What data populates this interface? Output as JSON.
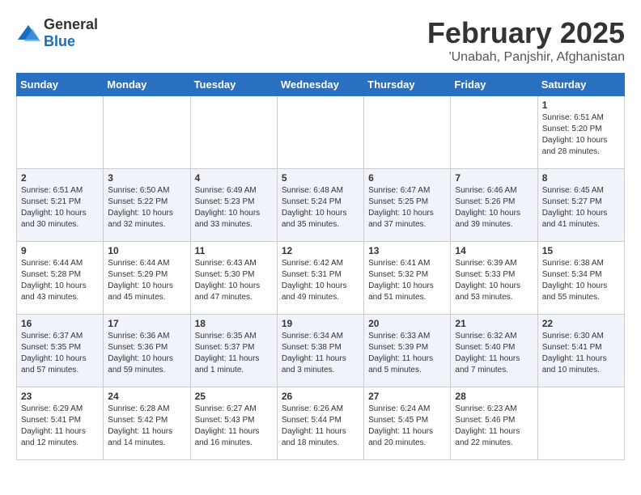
{
  "logo": {
    "general": "General",
    "blue": "Blue"
  },
  "title": "February 2025",
  "subtitle": "'Unabah, Panjshir, Afghanistan",
  "weekdays": [
    "Sunday",
    "Monday",
    "Tuesday",
    "Wednesday",
    "Thursday",
    "Friday",
    "Saturday"
  ],
  "weeks": [
    [
      {
        "day": "",
        "info": ""
      },
      {
        "day": "",
        "info": ""
      },
      {
        "day": "",
        "info": ""
      },
      {
        "day": "",
        "info": ""
      },
      {
        "day": "",
        "info": ""
      },
      {
        "day": "",
        "info": ""
      },
      {
        "day": "1",
        "info": "Sunrise: 6:51 AM\nSunset: 5:20 PM\nDaylight: 10 hours and 28 minutes."
      }
    ],
    [
      {
        "day": "2",
        "info": "Sunrise: 6:51 AM\nSunset: 5:21 PM\nDaylight: 10 hours and 30 minutes."
      },
      {
        "day": "3",
        "info": "Sunrise: 6:50 AM\nSunset: 5:22 PM\nDaylight: 10 hours and 32 minutes."
      },
      {
        "day": "4",
        "info": "Sunrise: 6:49 AM\nSunset: 5:23 PM\nDaylight: 10 hours and 33 minutes."
      },
      {
        "day": "5",
        "info": "Sunrise: 6:48 AM\nSunset: 5:24 PM\nDaylight: 10 hours and 35 minutes."
      },
      {
        "day": "6",
        "info": "Sunrise: 6:47 AM\nSunset: 5:25 PM\nDaylight: 10 hours and 37 minutes."
      },
      {
        "day": "7",
        "info": "Sunrise: 6:46 AM\nSunset: 5:26 PM\nDaylight: 10 hours and 39 minutes."
      },
      {
        "day": "8",
        "info": "Sunrise: 6:45 AM\nSunset: 5:27 PM\nDaylight: 10 hours and 41 minutes."
      }
    ],
    [
      {
        "day": "9",
        "info": "Sunrise: 6:44 AM\nSunset: 5:28 PM\nDaylight: 10 hours and 43 minutes."
      },
      {
        "day": "10",
        "info": "Sunrise: 6:44 AM\nSunset: 5:29 PM\nDaylight: 10 hours and 45 minutes."
      },
      {
        "day": "11",
        "info": "Sunrise: 6:43 AM\nSunset: 5:30 PM\nDaylight: 10 hours and 47 minutes."
      },
      {
        "day": "12",
        "info": "Sunrise: 6:42 AM\nSunset: 5:31 PM\nDaylight: 10 hours and 49 minutes."
      },
      {
        "day": "13",
        "info": "Sunrise: 6:41 AM\nSunset: 5:32 PM\nDaylight: 10 hours and 51 minutes."
      },
      {
        "day": "14",
        "info": "Sunrise: 6:39 AM\nSunset: 5:33 PM\nDaylight: 10 hours and 53 minutes."
      },
      {
        "day": "15",
        "info": "Sunrise: 6:38 AM\nSunset: 5:34 PM\nDaylight: 10 hours and 55 minutes."
      }
    ],
    [
      {
        "day": "16",
        "info": "Sunrise: 6:37 AM\nSunset: 5:35 PM\nDaylight: 10 hours and 57 minutes."
      },
      {
        "day": "17",
        "info": "Sunrise: 6:36 AM\nSunset: 5:36 PM\nDaylight: 10 hours and 59 minutes."
      },
      {
        "day": "18",
        "info": "Sunrise: 6:35 AM\nSunset: 5:37 PM\nDaylight: 11 hours and 1 minute."
      },
      {
        "day": "19",
        "info": "Sunrise: 6:34 AM\nSunset: 5:38 PM\nDaylight: 11 hours and 3 minutes."
      },
      {
        "day": "20",
        "info": "Sunrise: 6:33 AM\nSunset: 5:39 PM\nDaylight: 11 hours and 5 minutes."
      },
      {
        "day": "21",
        "info": "Sunrise: 6:32 AM\nSunset: 5:40 PM\nDaylight: 11 hours and 7 minutes."
      },
      {
        "day": "22",
        "info": "Sunrise: 6:30 AM\nSunset: 5:41 PM\nDaylight: 11 hours and 10 minutes."
      }
    ],
    [
      {
        "day": "23",
        "info": "Sunrise: 6:29 AM\nSunset: 5:41 PM\nDaylight: 11 hours and 12 minutes."
      },
      {
        "day": "24",
        "info": "Sunrise: 6:28 AM\nSunset: 5:42 PM\nDaylight: 11 hours and 14 minutes."
      },
      {
        "day": "25",
        "info": "Sunrise: 6:27 AM\nSunset: 5:43 PM\nDaylight: 11 hours and 16 minutes."
      },
      {
        "day": "26",
        "info": "Sunrise: 6:26 AM\nSunset: 5:44 PM\nDaylight: 11 hours and 18 minutes."
      },
      {
        "day": "27",
        "info": "Sunrise: 6:24 AM\nSunset: 5:45 PM\nDaylight: 11 hours and 20 minutes."
      },
      {
        "day": "28",
        "info": "Sunrise: 6:23 AM\nSunset: 5:46 PM\nDaylight: 11 hours and 22 minutes."
      },
      {
        "day": "",
        "info": ""
      }
    ]
  ]
}
